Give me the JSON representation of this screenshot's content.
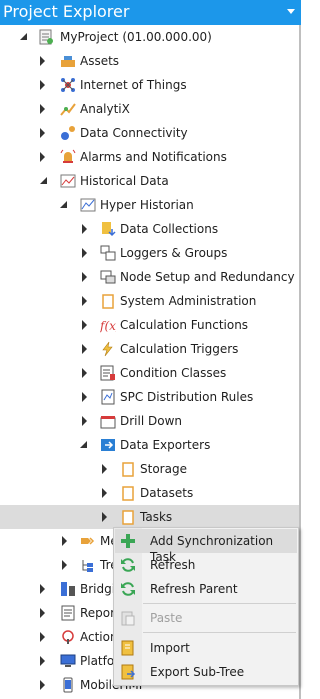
{
  "panel": {
    "title": "Project Explorer"
  },
  "tree": {
    "root": {
      "label": "MyProject (01.00.000.00)",
      "icon": "project-icon"
    },
    "items": [
      {
        "label": "Assets",
        "icon": "assets-icon"
      },
      {
        "label": "Internet of Things",
        "icon": "iot-icon"
      },
      {
        "label": "AnalytiX",
        "icon": "analytix-icon"
      },
      {
        "label": "Data Connectivity",
        "icon": "data-connectivity-icon"
      },
      {
        "label": "Alarms and Notifications",
        "icon": "alarm-icon"
      },
      {
        "label": "Historical Data",
        "icon": "historical-data-icon"
      },
      {
        "label": "Hyper Historian",
        "icon": "hyper-historian-icon"
      },
      {
        "label": "Data Collections",
        "icon": "data-collections-icon"
      },
      {
        "label": "Loggers & Groups",
        "icon": "loggers-icon"
      },
      {
        "label": "Node Setup and Redundancy",
        "icon": "node-setup-icon"
      },
      {
        "label": "System Administration",
        "icon": "folder-icon"
      },
      {
        "label": "Calculation Functions",
        "icon": "function-icon"
      },
      {
        "label": "Calculation Triggers",
        "icon": "lightning-icon"
      },
      {
        "label": "Condition Classes",
        "icon": "condition-icon"
      },
      {
        "label": "SPC Distribution Rules",
        "icon": "spc-icon"
      },
      {
        "label": "Drill Down",
        "icon": "drill-down-icon"
      },
      {
        "label": "Data Exporters",
        "icon": "data-exporters-icon"
      },
      {
        "label": "Storage",
        "icon": "folder-icon"
      },
      {
        "label": "Datasets",
        "icon": "folder-icon"
      },
      {
        "label": "Tasks",
        "icon": "folder-icon"
      },
      {
        "label": "Me",
        "icon": "metadata-icon"
      },
      {
        "label": "Tre",
        "icon": "tree-icon"
      },
      {
        "label": "Bridgin",
        "icon": "bridging-icon"
      },
      {
        "label": "Report",
        "icon": "reports-icon"
      },
      {
        "label": "Action",
        "icon": "actions-icon"
      },
      {
        "label": "Platfor",
        "icon": "platform-icon"
      },
      {
        "label": "MobileHMI",
        "icon": "mobile-icon"
      }
    ]
  },
  "context_menu": {
    "items": [
      {
        "label": "Add Synchronization Task",
        "icon": "plus-icon",
        "enabled": true
      },
      {
        "label": "Refresh",
        "icon": "refresh-icon",
        "enabled": true
      },
      {
        "label": "Refresh Parent",
        "icon": "refresh-icon",
        "enabled": true
      },
      {
        "label": "Paste",
        "icon": "paste-icon",
        "enabled": false
      },
      {
        "label": "Import",
        "icon": "import-icon",
        "enabled": true
      },
      {
        "label": "Export Sub-Tree",
        "icon": "export-icon",
        "enabled": true
      }
    ]
  },
  "colors": {
    "title_bar": "#1c97ea",
    "selection": "#dcdcdc",
    "menu_background": "#f2f2f2"
  }
}
